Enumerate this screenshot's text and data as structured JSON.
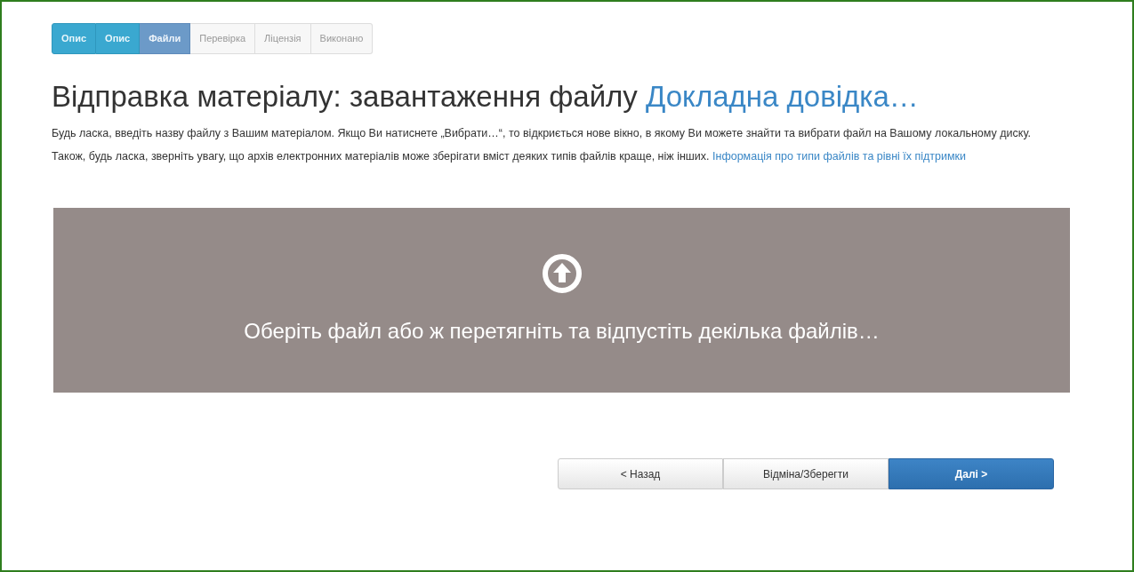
{
  "steps": [
    {
      "label": "Опис",
      "kind": "done"
    },
    {
      "label": "Опис",
      "kind": "done"
    },
    {
      "label": "Файли",
      "kind": "current"
    },
    {
      "label": "Перевірка",
      "kind": "pending"
    },
    {
      "label": "Ліцензія",
      "kind": "pending"
    },
    {
      "label": "Виконано",
      "kind": "pending"
    }
  ],
  "heading": {
    "title": "Відправка матеріалу: завантаження файлу",
    "help_link": "Докладна довідка…"
  },
  "paragraphs": [
    {
      "text": "Будь ласка, введіть назву файлу з Вашим матеріалом. Якщо Ви натиснете „Вибрати…“, то відкриється нове вікно, в якому Ви можете знайти та вибрати файл на Вашому локальному диску."
    },
    {
      "text": "Також, будь ласка, зверніть увагу, що архів електронних матеріалів може зберігати вміст деяких типів файлів краще, ніж інших.",
      "link": "Інформація про типи файлів та рівні їх підтримки"
    }
  ],
  "dropzone": {
    "label": "Оберіть файл або ж перетягніть та відпустіть декілька файлів…"
  },
  "buttons": [
    {
      "label": "< Назад",
      "kind": "default"
    },
    {
      "label": "Відміна/Зберегти",
      "kind": "default"
    },
    {
      "label": "Далі >",
      "kind": "primary"
    }
  ]
}
